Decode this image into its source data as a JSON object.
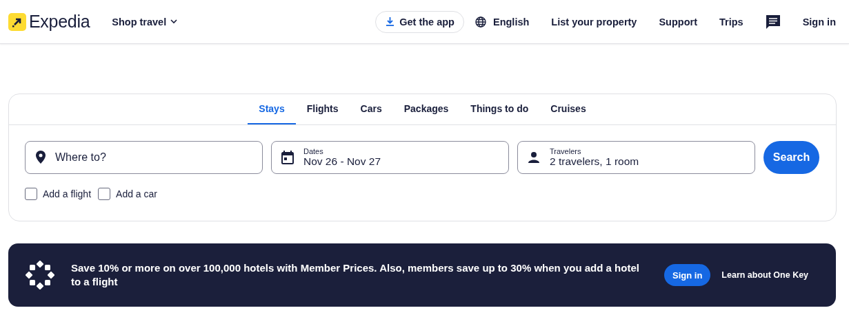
{
  "header": {
    "logo_text": "Expedia",
    "shop_travel": "Shop travel",
    "get_app": "Get the app",
    "language": "English",
    "links": [
      "List your property",
      "Support",
      "Trips"
    ],
    "sign_in": "Sign in"
  },
  "search": {
    "tabs": [
      {
        "label": "Stays",
        "selected": true
      },
      {
        "label": "Flights",
        "selected": false
      },
      {
        "label": "Cars",
        "selected": false
      },
      {
        "label": "Packages",
        "selected": false
      },
      {
        "label": "Things to do",
        "selected": false
      },
      {
        "label": "Cruises",
        "selected": false
      }
    ],
    "fields": [
      {
        "kind": "destination",
        "placeholder": "Where to?"
      },
      {
        "kind": "dates",
        "label": "Dates",
        "value": "Nov 26 - Nov 27"
      },
      {
        "kind": "travelers",
        "label": "Travelers",
        "value": "2 travelers, 1 room"
      }
    ],
    "button": "Search",
    "addons": [
      {
        "label": "Add a flight",
        "checked": false
      },
      {
        "label": "Add a car",
        "checked": false
      }
    ]
  },
  "banner": {
    "text": "Save 10% or more on over 100,000 hotels with Member Prices. Also, members save up to 30% when you add a hotel to a flight",
    "button": "Sign in",
    "link": "Learn about One Key"
  }
}
